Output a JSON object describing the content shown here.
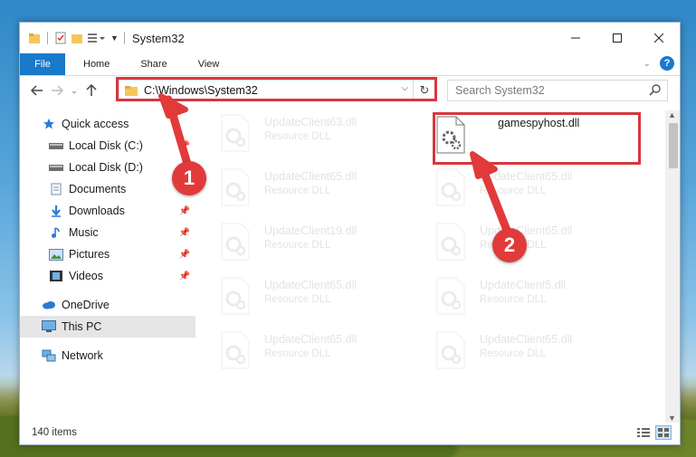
{
  "window": {
    "title": "System32"
  },
  "ribbon": {
    "tabs": [
      "File",
      "Home",
      "Share",
      "View"
    ],
    "help": "?"
  },
  "nav": {
    "address": "C:\\Windows\\System32",
    "search_placeholder": "Search System32"
  },
  "sidebar": {
    "items": [
      {
        "label": "Quick access",
        "icon": "star-icon",
        "pinned": false
      },
      {
        "label": "Local Disk (C:)",
        "icon": "drive-icon",
        "pinned": true
      },
      {
        "label": "Local Disk (D:)",
        "icon": "drive-icon",
        "pinned": false
      },
      {
        "label": "Documents",
        "icon": "documents-icon",
        "pinned": true
      },
      {
        "label": "Downloads",
        "icon": "downloads-icon",
        "pinned": true
      },
      {
        "label": "Music",
        "icon": "music-icon",
        "pinned": true
      },
      {
        "label": "Pictures",
        "icon": "pictures-icon",
        "pinned": true
      },
      {
        "label": "Videos",
        "icon": "videos-icon",
        "pinned": true
      },
      {
        "label": "OneDrive",
        "icon": "cloud-icon",
        "pinned": false
      },
      {
        "label": "This PC",
        "icon": "computer-icon",
        "pinned": false,
        "selected": true
      },
      {
        "label": "Network",
        "icon": "network-icon",
        "pinned": false
      }
    ]
  },
  "files": {
    "left": [
      {
        "name": "UpdateClient63.dll",
        "type": "Resource DLL"
      },
      {
        "name": "UpdateClient65.dll",
        "type": "Resource DLL"
      },
      {
        "name": "UpdateClient19.dll",
        "type": "Resource DLL"
      },
      {
        "name": "UpdateClient65.dll",
        "type": "Resource DLL"
      },
      {
        "name": "UpdateClient65.dll",
        "type": "Resource DLL"
      }
    ],
    "right": [
      {
        "name": "gamespyhost.dll",
        "type": ""
      },
      {
        "name": "UpdateClient65.dll",
        "type": "Resource DLL"
      },
      {
        "name": "UpdateClient65.dll",
        "type": "Resource DLL"
      },
      {
        "name": "UpdateClient5.dll",
        "type": "Resource DLL"
      },
      {
        "name": "UpdateClient65.dll",
        "type": "Resource DLL"
      }
    ]
  },
  "status": {
    "count": "140 items"
  },
  "annotations": {
    "step1": "1",
    "step2": "2"
  },
  "colors": {
    "accent": "#1979ca",
    "highlight": "#d9363e"
  }
}
